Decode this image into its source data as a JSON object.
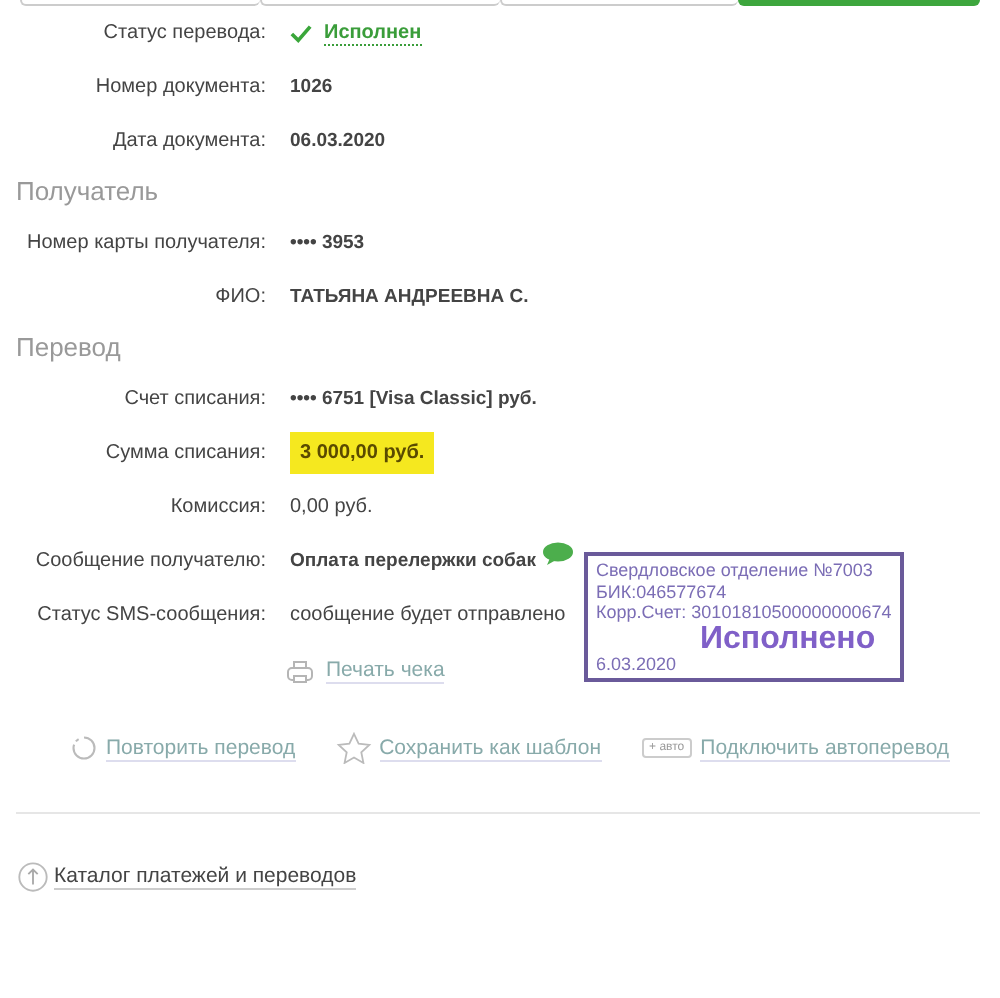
{
  "progress": {
    "steps": [
      {
        "selected": false
      },
      {
        "selected": false
      },
      {
        "selected": false
      },
      {
        "selected": true
      }
    ]
  },
  "sections": [
    {
      "rows": [
        {
          "label": "Статус перевода:",
          "value": "Исполнен",
          "kind": "status"
        },
        {
          "label": "Номер документа:",
          "value": "1026",
          "kind": "bold"
        },
        {
          "label": "Дата документа:",
          "value": "06.03.2020",
          "kind": "bold"
        }
      ]
    },
    {
      "title": "Получатель",
      "rows": [
        {
          "label": "Номер карты получателя:",
          "value": "•••• 3953",
          "kind": "bold"
        },
        {
          "label": "ФИО:",
          "value": "ТАТЬЯНА АНДРЕЕВНА С.",
          "kind": "bold"
        }
      ]
    },
    {
      "title": "Перевод",
      "rows": [
        {
          "label": "Счет списания:",
          "value": "•••• 6751  [Visa Classic]  руб.",
          "kind": "bold"
        },
        {
          "label": "Сумма списания:",
          "value": "3 000,00  руб.",
          "kind": "amount"
        },
        {
          "label": "Комиссия:",
          "value": "0,00 руб.",
          "kind": "plain"
        },
        {
          "label": "Сообщение получателю:",
          "value": "Оплата перелержки собак",
          "kind": "message"
        },
        {
          "label": "Статус SMS-сообщения:",
          "value": "сообщение будет отправлено",
          "kind": "plain"
        }
      ]
    }
  ],
  "print_link": "Печать чека",
  "actions": [
    {
      "label": "Повторить перевод",
      "kind": "repeat"
    },
    {
      "label": "Сохранить как шаблон",
      "kind": "star"
    },
    {
      "label": "Подключить автоперевод",
      "kind": "auto",
      "badge": "+ авто"
    }
  ],
  "catalog_link": "Каталог платежей и переводов",
  "stamp": {
    "lines": [
      "Свердловское отделение №7003",
      "БИК:046577674",
      "Корр.Счет: 30101810500000000674"
    ],
    "title": "Исполнено",
    "date": "6.03.2020"
  }
}
